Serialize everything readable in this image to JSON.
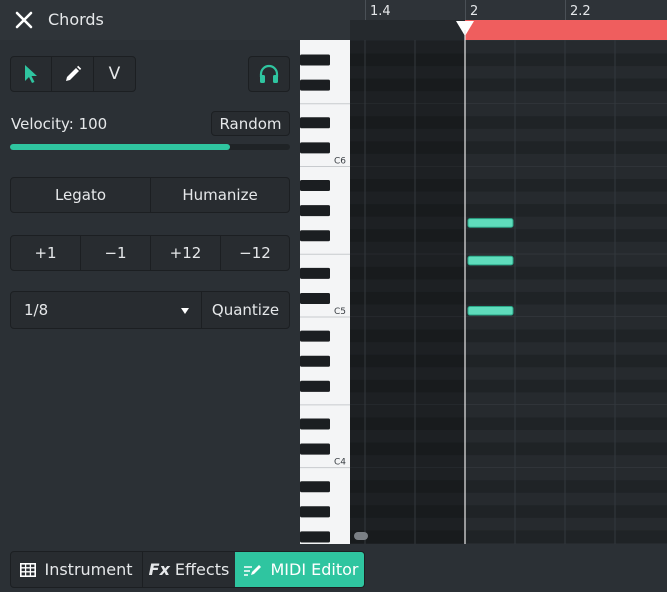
{
  "header": {
    "title": "Chords",
    "close_icon": "close-icon"
  },
  "tools": {
    "items": [
      {
        "name": "select-tool",
        "icon": "cursor-arrow-icon",
        "active": true
      },
      {
        "name": "pencil-tool",
        "icon": "pencil-icon",
        "active": false
      },
      {
        "name": "velocity-tool",
        "label": "V",
        "active": false
      }
    ],
    "preview_icon": "headphones-icon"
  },
  "velocity": {
    "label": "Velocity: 100",
    "value": 100,
    "max": 127,
    "random_label": "Random"
  },
  "note_actions": {
    "legato_label": "Legato",
    "humanize_label": "Humanize"
  },
  "transpose": {
    "buttons": [
      "+1",
      "−1",
      "+12",
      "−12"
    ]
  },
  "quantize": {
    "grid_value": "1/8",
    "button_label": "Quantize"
  },
  "tabs": [
    {
      "label": "Instrument",
      "icon": "grid-icon",
      "active": false
    },
    {
      "label": "Effects",
      "icon_text": "Fx",
      "active": false
    },
    {
      "label": "MIDI Editor",
      "icon": "midi-pen-icon",
      "active": true
    }
  ],
  "ruler": {
    "labels": [
      "1.4",
      "2",
      "2.2"
    ]
  },
  "keyboard": {
    "labels": [
      "C6",
      "C5",
      "C4"
    ]
  },
  "colors": {
    "accent": "#2fc5a0",
    "loop": "#ef5e5e",
    "note": "#5fdcbc",
    "panel": "#2b3035"
  }
}
